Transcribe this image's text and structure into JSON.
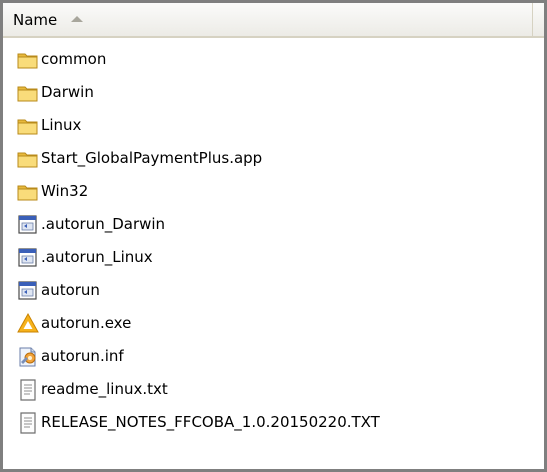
{
  "header": {
    "name_label": "Name"
  },
  "files": [
    {
      "name": "common",
      "icon": "folder-icon"
    },
    {
      "name": "Darwin",
      "icon": "folder-icon"
    },
    {
      "name": "Linux",
      "icon": "folder-icon"
    },
    {
      "name": "Start_GlobalPaymentPlus.app",
      "icon": "folder-icon"
    },
    {
      "name": "Win32",
      "icon": "folder-icon"
    },
    {
      "name": ".autorun_Darwin",
      "icon": "application-window-icon"
    },
    {
      "name": ".autorun_Linux",
      "icon": "application-window-icon"
    },
    {
      "name": "autorun",
      "icon": "application-window-icon"
    },
    {
      "name": "autorun.exe",
      "icon": "yellow-logo-icon"
    },
    {
      "name": "autorun.inf",
      "icon": "settings-file-icon"
    },
    {
      "name": "readme_linux.txt",
      "icon": "text-file-icon"
    },
    {
      "name": "RELEASE_NOTES_FFCOBA_1.0.20150220.TXT",
      "icon": "text-file-icon"
    }
  ],
  "colors": {
    "folder_yellow": "#f5d36a",
    "border_gray": "#7f7f7f",
    "header_bg": "#ecebe6"
  }
}
